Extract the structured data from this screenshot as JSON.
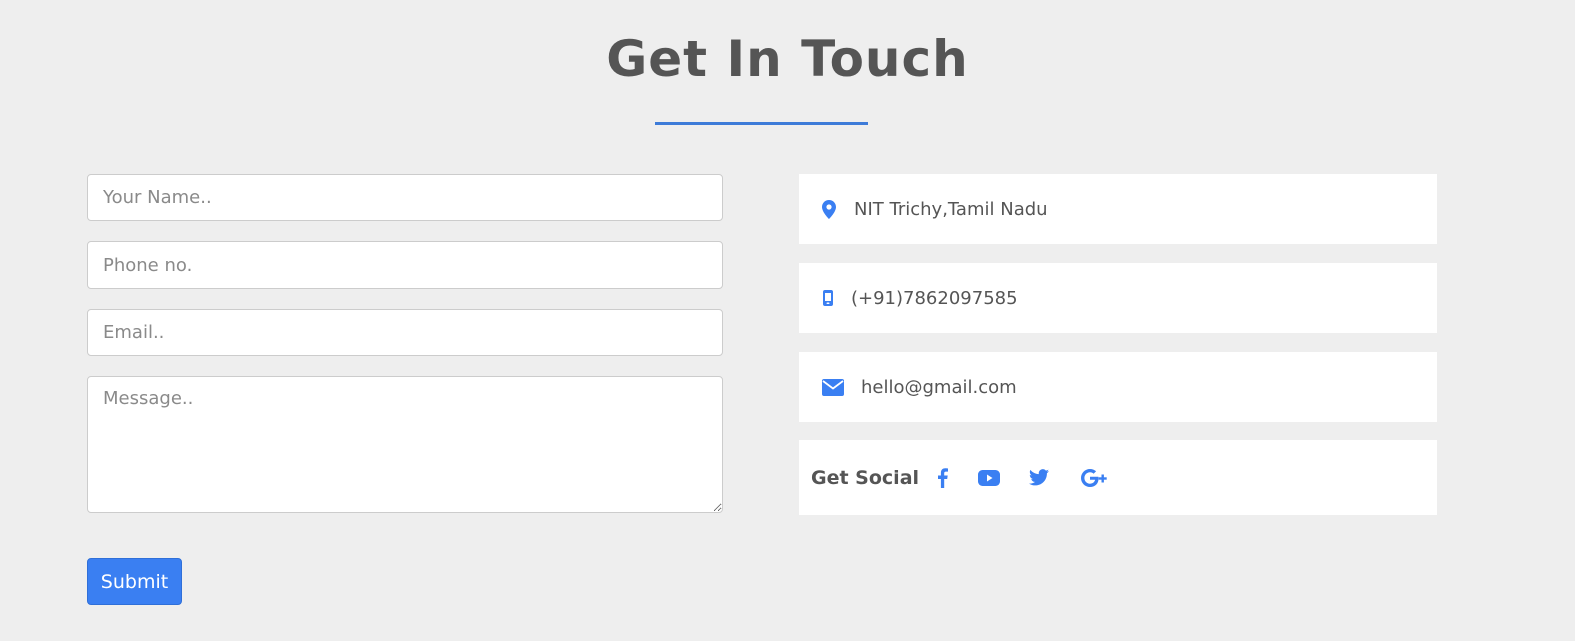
{
  "section": {
    "title": "Get In Touch"
  },
  "form": {
    "name_placeholder": "Your Name..",
    "phone_placeholder": "Phone no.",
    "email_placeholder": "Email..",
    "message_placeholder": "Message..",
    "submit_label": "Submit"
  },
  "contact": {
    "address": "NIT Trichy,Tamil Nadu",
    "address_icon": "map-marker-icon",
    "phone": "(+91)7862097585",
    "phone_icon": "mobile-phone-icon",
    "email": "hello@gmail.com",
    "email_icon": "envelope-icon"
  },
  "social": {
    "label": "Get Social",
    "links": [
      {
        "icon": "facebook-icon"
      },
      {
        "icon": "youtube-icon"
      },
      {
        "icon": "twitter-icon"
      },
      {
        "icon": "google-plus-icon"
      }
    ]
  },
  "colors": {
    "accent": "#3a7ff2",
    "background": "#eeeeee",
    "text": "#555555",
    "panel": "#ffffff"
  }
}
